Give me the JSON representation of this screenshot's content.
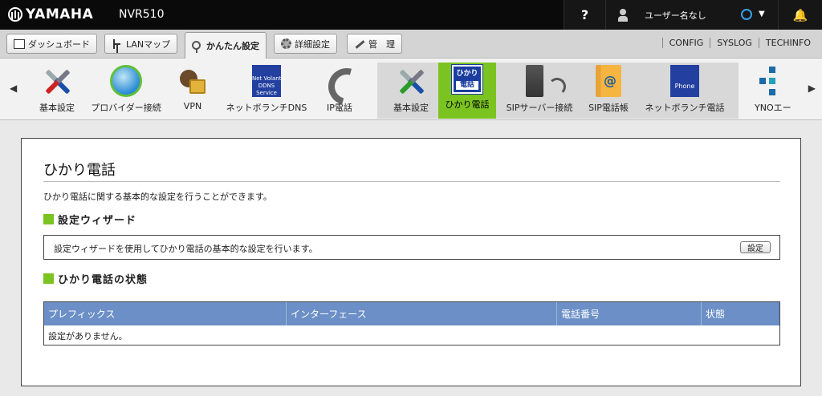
{
  "header": {
    "brand": "YAMAHA",
    "model": "NVR510",
    "help": "?",
    "user": "ユーザー名なし",
    "caret": "▼",
    "bell": "🔔"
  },
  "nav": {
    "tabs": [
      {
        "label": "ダッシュボード"
      },
      {
        "label": "LANマップ"
      },
      {
        "label": "かんたん設定"
      },
      {
        "label": "詳細設定"
      },
      {
        "label": "管　理"
      }
    ],
    "links": [
      "CONFIG",
      "SYSLOG",
      "TECHINFO"
    ]
  },
  "ribbon": {
    "left_arrow": "◀",
    "right_arrow": "▶",
    "items": [
      {
        "label": "基本設定"
      },
      {
        "label": "プロバイダー接続"
      },
      {
        "label": "VPN"
      },
      {
        "label": "ネットボランチDNS",
        "icon_text": [
          "Net Volante",
          "DDNS",
          "Service"
        ]
      },
      {
        "label": "IP電話"
      }
    ],
    "sub_items": [
      {
        "label": "基本設定"
      },
      {
        "label": "ひかり電話",
        "icon_text": [
          "ひかり",
          "電話"
        ]
      },
      {
        "label": "SIPサーバー接続"
      },
      {
        "label": "SIP電話帳"
      },
      {
        "label": "ネットボランチ電話",
        "icon_text": [
          "Phone"
        ]
      },
      {
        "label": "YNOエー"
      }
    ]
  },
  "page": {
    "title": "ひかり電話",
    "description": "ひかり電話に関する基本的な設定を行うことができます。",
    "wizard": {
      "heading": "設定ウィザード",
      "text": "設定ウィザードを使用してひかり電話の基本的な設定を行います。",
      "button": "設定"
    },
    "status": {
      "heading": "ひかり電話の状態",
      "columns": [
        "プレフィックス",
        "インターフェース",
        "電話番号",
        "状態"
      ],
      "empty": "設定がありません。"
    }
  },
  "colors": {
    "accent_green": "#7bc320",
    "table_header": "#6b8fc6",
    "header_bg": "#0a0a0a"
  }
}
